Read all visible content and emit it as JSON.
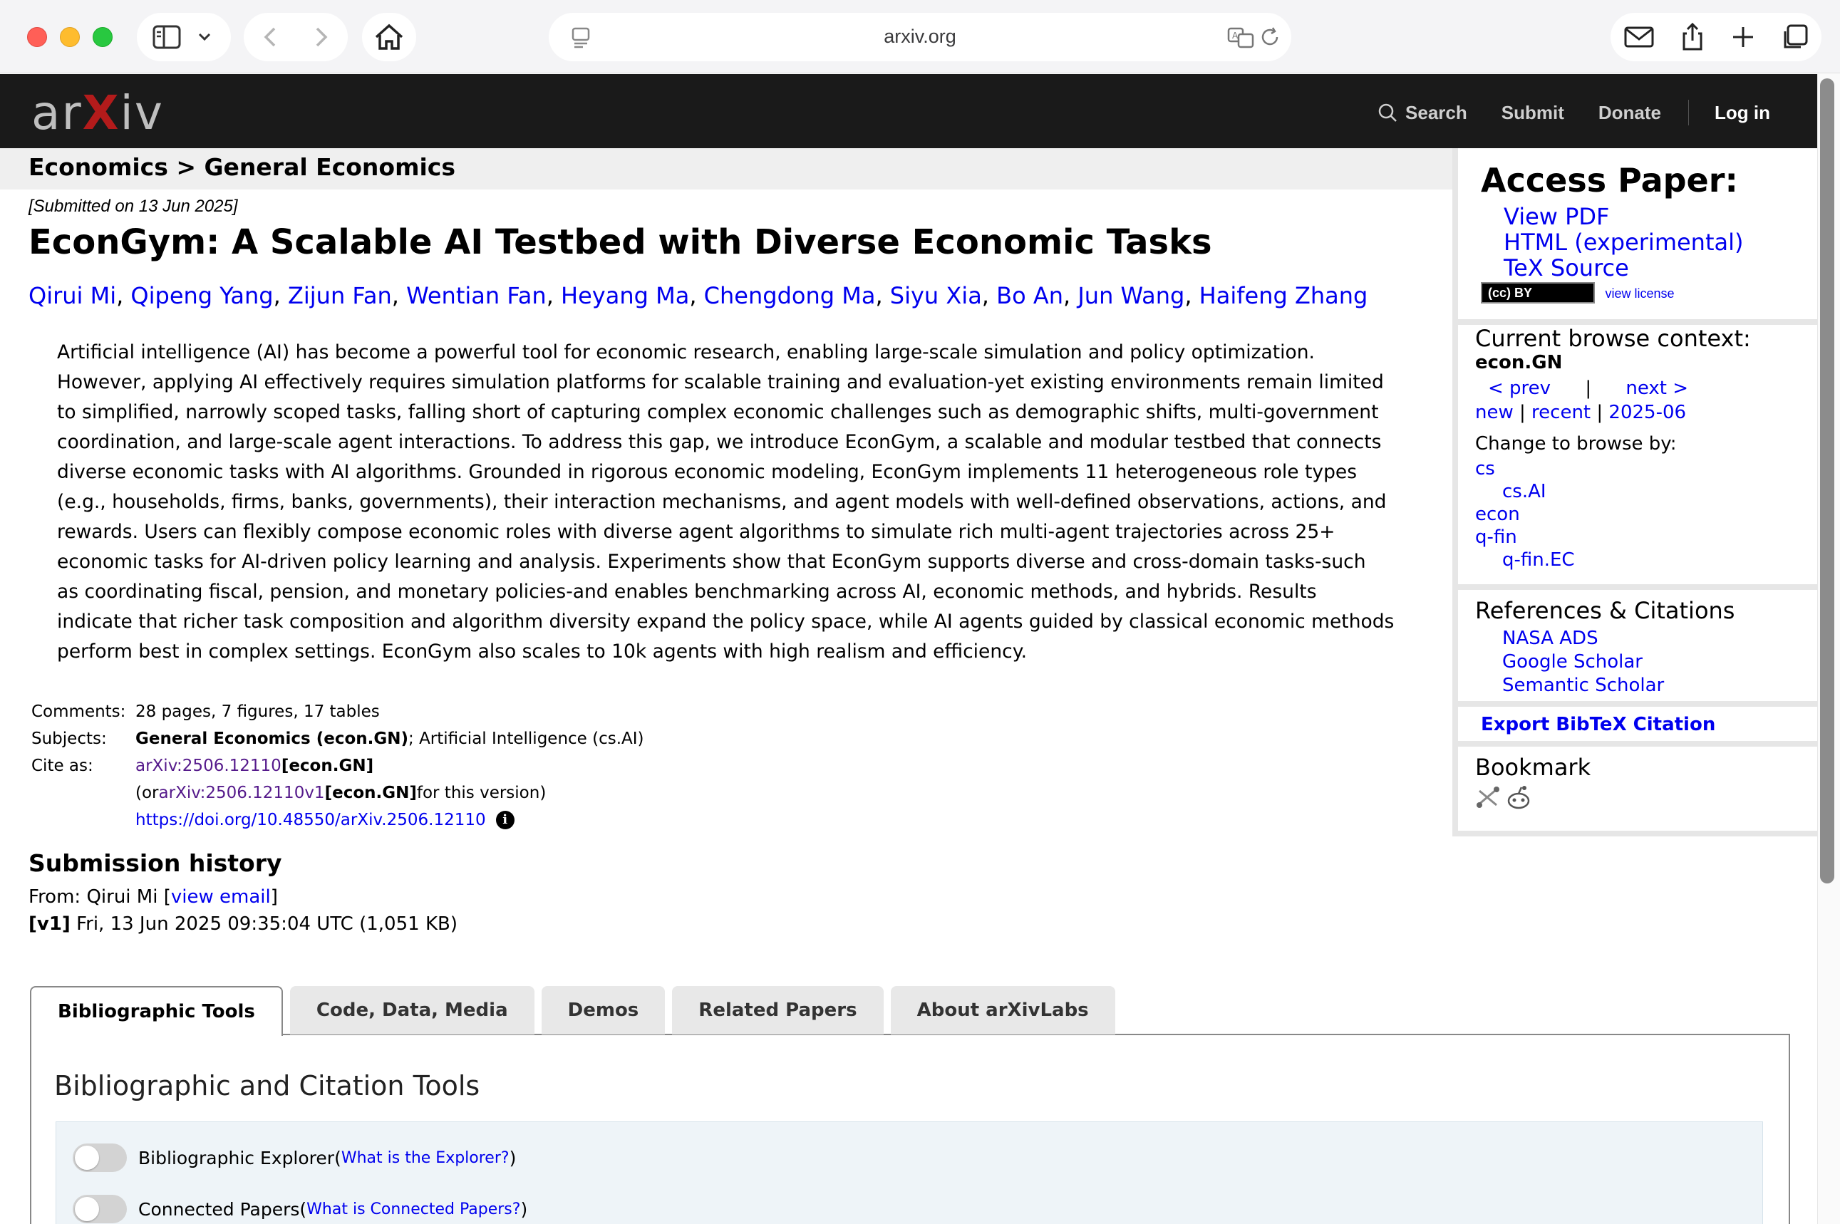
{
  "browser": {
    "url": "arxiv.org"
  },
  "header": {
    "logo": "arXiv",
    "search": "Search",
    "submit": "Submit",
    "donate": "Donate",
    "login": "Log in"
  },
  "breadcrumb": "Economics > General Economics",
  "paper": {
    "submitted": "[Submitted on 13 Jun 2025]",
    "title": "EconGym: A Scalable AI Testbed with Diverse Economic Tasks",
    "authors": [
      "Qirui Mi",
      "Qipeng Yang",
      "Zijun Fan",
      "Wentian Fan",
      "Heyang Ma",
      "Chengdong Ma",
      "Siyu Xia",
      "Bo An",
      "Jun Wang",
      "Haifeng Zhang"
    ],
    "abstract_lines": [
      "Artificial intelligence (AI) has become a powerful tool for economic research, enabling large-scale simulation and policy optimization.",
      "However, applying AI effectively requires simulation platforms for scalable training and evaluation-yet existing environments remain limited",
      "to simplified, narrowly scoped tasks, falling short of capturing complex economic challenges such as demographic shifts, multi-government",
      "coordination, and large-scale agent interactions. To address this gap, we introduce EconGym, a scalable and modular testbed that connects",
      "diverse economic tasks with AI algorithms. Grounded in rigorous economic modeling, EconGym implements 11 heterogeneous role types",
      "(e.g., households, firms, banks, governments), their interaction mechanisms, and agent models with well-defined observations, actions, and",
      "rewards. Users can flexibly compose economic roles with diverse agent algorithms to simulate rich multi-agent trajectories across 25+",
      "economic tasks for AI-driven policy learning and analysis. Experiments show that EconGym supports diverse and cross-domain tasks-such",
      "as coordinating fiscal, pension, and monetary policies-and enables benchmarking across AI, economic methods, and hybrids. Results",
      "indicate that richer task composition and algorithm diversity expand the policy space, while AI agents guided by classical economic methods",
      "perform best in complex settings. EconGym also scales to 10k agents with high realism and efficiency."
    ]
  },
  "meta": {
    "comments_label": "Comments:",
    "comments": "28 pages, 7 figures, 17 tables",
    "subjects_label": "Subjects:",
    "subjects_primary": "General Economics (econ.GN)",
    "subjects_rest": "; Artificial Intelligence (cs.AI)",
    "cite_label": "Cite as:",
    "cite_id": "arXiv:2506.12110",
    "cite_cat": " [econ.GN]",
    "version_pre": "(or ",
    "version_id": "arXiv:2506.12110v1",
    "version_cat": " [econ.GN]",
    "version_post": " for this version)",
    "doi": "https://doi.org/10.48550/arXiv.2506.12110",
    "info_glyph": "i"
  },
  "history": {
    "heading": "Submission history",
    "from_pre": "From: Qirui Mi [",
    "from_link": "view email",
    "from_post": "]",
    "v1_tag": "[v1]",
    "v1_text": " Fri, 13 Jun 2025 09:35:04 UTC (1,051 KB)"
  },
  "tabs": [
    "Bibliographic Tools",
    "Code, Data, Media",
    "Demos",
    "Related Papers",
    "About arXivLabs"
  ],
  "tools": {
    "heading": "Bibliographic and Citation Tools",
    "explorer_label": "Bibliographic Explorer ",
    "explorer_link": "What is the Explorer?",
    "connected_label": "Connected Papers ",
    "connected_link": "What is Connected Papers?",
    "paren_open": "(",
    "paren_close": ")"
  },
  "sidebar": {
    "access_heading": "Access Paper:",
    "view_pdf": "View PDF",
    "html": "HTML (experimental)",
    "tex": "TeX Source",
    "cc_badge": "(cc) BY",
    "view_license": "view license",
    "context_heading": "Current browse context:",
    "context": "econ.GN",
    "prev": "< prev",
    "pipe": "|",
    "next": "next >",
    "new": "new",
    "recent": "recent",
    "month": "2025-06",
    "change_label": "Change to browse by:",
    "browse": [
      "cs",
      "cs.AI",
      "econ",
      "q-fin",
      "q-fin.EC"
    ],
    "refs_heading": "References & Citations",
    "refs": [
      "NASA ADS",
      "Google Scholar",
      "Semantic Scholar"
    ],
    "export": "Export BibTeX Citation",
    "bookmark_heading": "Bookmark"
  },
  "colors": {
    "header_bg": "#1a1a1a",
    "arxiv_red": "#b31b1b",
    "link": "#0000ee",
    "visited": "#551a8b"
  }
}
